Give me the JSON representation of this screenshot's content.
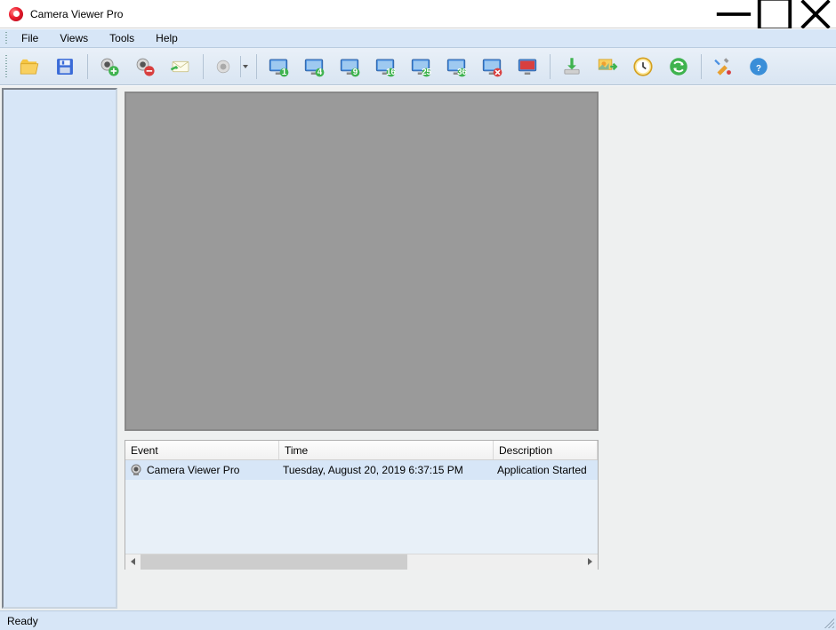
{
  "title": "Camera Viewer Pro",
  "menu": {
    "file": "File",
    "views": "Views",
    "tools": "Tools",
    "help": "Help"
  },
  "toolbar": {
    "open": "open-folder",
    "save": "save",
    "add": "add-camera",
    "remove": "remove-camera",
    "mail": "mail",
    "record": "record",
    "view1": "view-1",
    "view4": "view-4",
    "view9": "view-9",
    "view16": "view-16",
    "view25": "view-25",
    "view36": "view-36",
    "disconnect": "disconnect",
    "fullscreen": "fullscreen",
    "download": "download",
    "export": "export",
    "schedule": "schedule",
    "refresh": "refresh",
    "settings": "settings",
    "help": "help"
  },
  "events": {
    "headers": {
      "event": "Event",
      "time": "Time",
      "desc": "Description"
    },
    "rows": [
      {
        "event": "Camera Viewer Pro",
        "time": "Tuesday, August 20, 2019 6:37:15 PM",
        "desc": "Application Started"
      }
    ]
  },
  "status": "Ready"
}
